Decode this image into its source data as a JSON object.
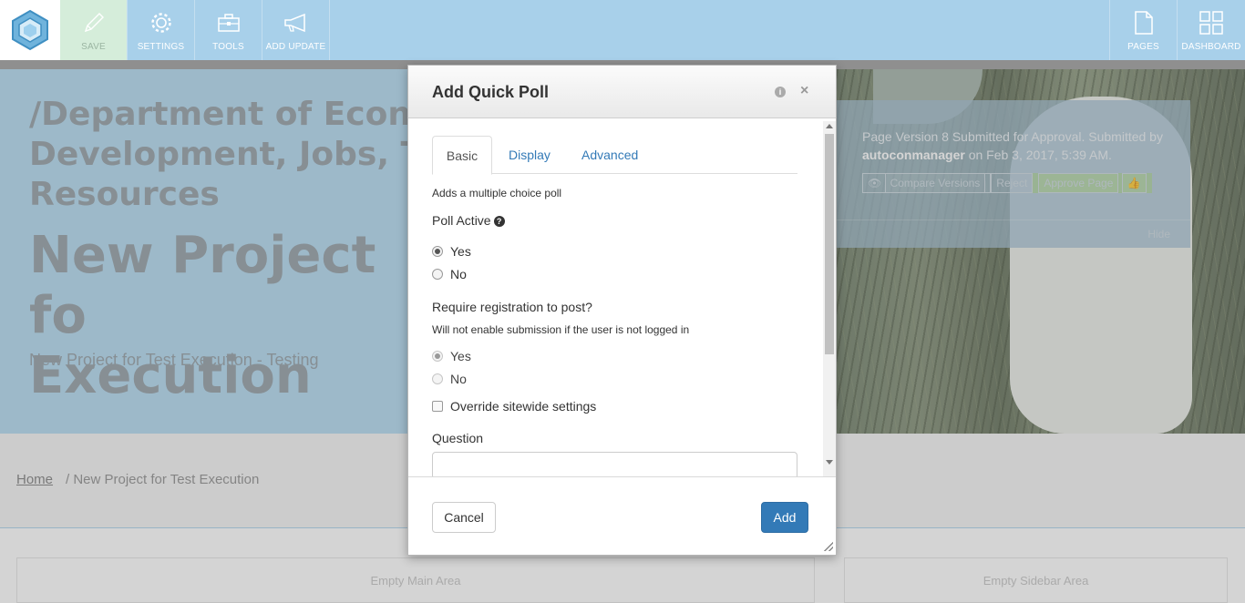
{
  "toolbar": {
    "save_label": "SAVE",
    "settings_label": "SETTINGS",
    "tools_label": "TOOLS",
    "add_update_label": "ADD UPDATE",
    "pages_label": "PAGES",
    "dashboard_label": "DASHBOARD",
    "icons": [
      "logo-icon",
      "pencil-icon",
      "gear-icon",
      "toolbox-icon",
      "megaphone-icon",
      "page-icon",
      "grid-icon"
    ]
  },
  "hero": {
    "path": "/Department of Econ\nDevelopment, Jobs, T\nResources",
    "title": "New Project fo\nExecution",
    "subtitle": "New Project for Test Execution - Testing"
  },
  "approval": {
    "message_prefix": "Page Version 8 Submitted for Approval. Submitted by",
    "user": "autoconmanager",
    "message_suffix": "on Feb 3, 2017, 5:39 AM.",
    "compare_label": "Compare Versions",
    "reject_label": "Reject",
    "approve_label": "Approve Page",
    "hide_label": "Hide"
  },
  "breadcrumb": {
    "home": "Home",
    "current": "/ New Project for Test Execution"
  },
  "areas": {
    "main": "Empty Main Area",
    "sidebar": "Empty Sidebar Area"
  },
  "modal": {
    "title": "Add Quick Poll",
    "tabs": [
      "Basic",
      "Display",
      "Advanced"
    ],
    "description": "Adds a multiple choice poll",
    "poll_active_label": "Poll Active",
    "poll_active_options": [
      "Yes",
      "No"
    ],
    "poll_active_value": "Yes",
    "registration_label": "Require registration to post?",
    "registration_help": "Will not enable submission if the user is not logged in",
    "registration_options": [
      "Yes",
      "No"
    ],
    "registration_value": "Yes",
    "override_label": "Override sitewide settings",
    "override_checked": false,
    "question_label": "Question",
    "question_value": "",
    "cancel_label": "Cancel",
    "add_label": "Add"
  },
  "colors": {
    "toolbar": "#a8d0ea",
    "hero": "#aed7ef",
    "primary_button": "#337ab7",
    "approve": "#a9cf9f"
  }
}
